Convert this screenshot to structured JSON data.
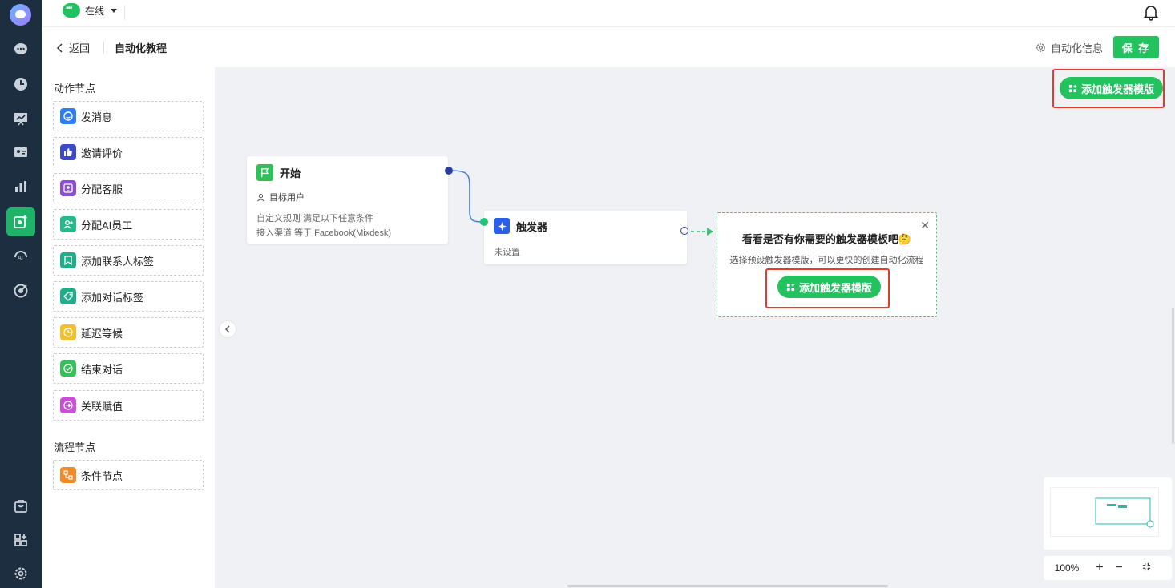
{
  "topbar": {
    "status": "在线"
  },
  "subheader": {
    "back_label": "返回",
    "title": "自动化教程",
    "info_label": "自动化信息",
    "save_label": "保 存"
  },
  "palette": {
    "action_title": "动作节点",
    "actions": [
      {
        "label": "发消息",
        "color": "#2f7df6"
      },
      {
        "label": "邀请评价",
        "color": "#3d49c8"
      },
      {
        "label": "分配客服",
        "color": "#8a4ed6"
      },
      {
        "label": "分配AI员工",
        "color": "#25b98a"
      },
      {
        "label": "添加联系人标签",
        "color": "#1fae8a"
      },
      {
        "label": "添加对话标签",
        "color": "#1fae8a"
      },
      {
        "label": "延迟等候",
        "color": "#f2c02c"
      },
      {
        "label": "结束对话",
        "color": "#37c05a"
      },
      {
        "label": "关联赋值",
        "color": "#c84fd6"
      }
    ],
    "flow_title": "流程节点",
    "flows": [
      {
        "label": "条件节点",
        "color": "#f08a2a"
      }
    ]
  },
  "canvas": {
    "start_node": {
      "title": "开始",
      "target": "目标用户",
      "rule_line1": "自定义规则 满足以下任意条件",
      "rule_line2": "接入渠道  等于  Facebook(Mixdesk)"
    },
    "trigger_node": {
      "title": "触发器",
      "subtitle": "未设置"
    },
    "template_panel": {
      "title": "看看是否有你需要的触发器模板吧🤔",
      "desc": "选择预设触发器模版，可以更快的创建自动化流程",
      "button": "添加触发器模版"
    },
    "top_button": "添加触发器模版",
    "zoom": "100%"
  },
  "colors": {
    "accent": "#22c25f",
    "rail": "#1c2e40",
    "highlight": "#e8382c"
  }
}
